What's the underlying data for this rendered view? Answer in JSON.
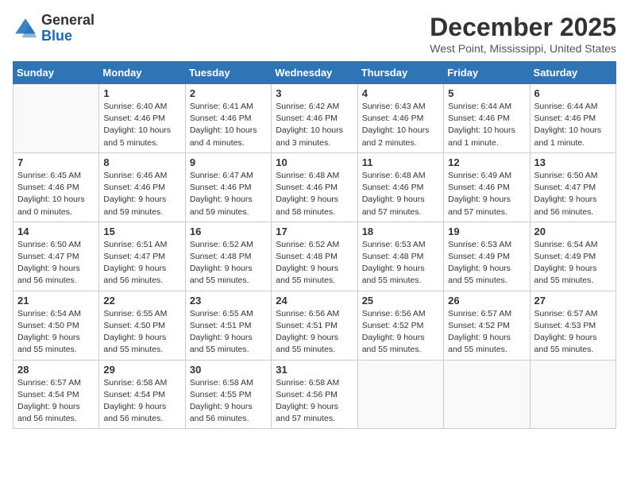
{
  "logo": {
    "general": "General",
    "blue": "Blue"
  },
  "title": "December 2025",
  "location": "West Point, Mississippi, United States",
  "weekdays": [
    "Sunday",
    "Monday",
    "Tuesday",
    "Wednesday",
    "Thursday",
    "Friday",
    "Saturday"
  ],
  "weeks": [
    [
      {
        "day": "",
        "sunrise": "",
        "sunset": "",
        "daylight": ""
      },
      {
        "day": "1",
        "sunrise": "Sunrise: 6:40 AM",
        "sunset": "Sunset: 4:46 PM",
        "daylight": "Daylight: 10 hours and 5 minutes."
      },
      {
        "day": "2",
        "sunrise": "Sunrise: 6:41 AM",
        "sunset": "Sunset: 4:46 PM",
        "daylight": "Daylight: 10 hours and 4 minutes."
      },
      {
        "day": "3",
        "sunrise": "Sunrise: 6:42 AM",
        "sunset": "Sunset: 4:46 PM",
        "daylight": "Daylight: 10 hours and 3 minutes."
      },
      {
        "day": "4",
        "sunrise": "Sunrise: 6:43 AM",
        "sunset": "Sunset: 4:46 PM",
        "daylight": "Daylight: 10 hours and 2 minutes."
      },
      {
        "day": "5",
        "sunrise": "Sunrise: 6:44 AM",
        "sunset": "Sunset: 4:46 PM",
        "daylight": "Daylight: 10 hours and 1 minute."
      },
      {
        "day": "6",
        "sunrise": "Sunrise: 6:44 AM",
        "sunset": "Sunset: 4:46 PM",
        "daylight": "Daylight: 10 hours and 1 minute."
      }
    ],
    [
      {
        "day": "7",
        "sunrise": "Sunrise: 6:45 AM",
        "sunset": "Sunset: 4:46 PM",
        "daylight": "Daylight: 10 hours and 0 minutes."
      },
      {
        "day": "8",
        "sunrise": "Sunrise: 6:46 AM",
        "sunset": "Sunset: 4:46 PM",
        "daylight": "Daylight: 9 hours and 59 minutes."
      },
      {
        "day": "9",
        "sunrise": "Sunrise: 6:47 AM",
        "sunset": "Sunset: 4:46 PM",
        "daylight": "Daylight: 9 hours and 59 minutes."
      },
      {
        "day": "10",
        "sunrise": "Sunrise: 6:48 AM",
        "sunset": "Sunset: 4:46 PM",
        "daylight": "Daylight: 9 hours and 58 minutes."
      },
      {
        "day": "11",
        "sunrise": "Sunrise: 6:48 AM",
        "sunset": "Sunset: 4:46 PM",
        "daylight": "Daylight: 9 hours and 57 minutes."
      },
      {
        "day": "12",
        "sunrise": "Sunrise: 6:49 AM",
        "sunset": "Sunset: 4:46 PM",
        "daylight": "Daylight: 9 hours and 57 minutes."
      },
      {
        "day": "13",
        "sunrise": "Sunrise: 6:50 AM",
        "sunset": "Sunset: 4:47 PM",
        "daylight": "Daylight: 9 hours and 56 minutes."
      }
    ],
    [
      {
        "day": "14",
        "sunrise": "Sunrise: 6:50 AM",
        "sunset": "Sunset: 4:47 PM",
        "daylight": "Daylight: 9 hours and 56 minutes."
      },
      {
        "day": "15",
        "sunrise": "Sunrise: 6:51 AM",
        "sunset": "Sunset: 4:47 PM",
        "daylight": "Daylight: 9 hours and 56 minutes."
      },
      {
        "day": "16",
        "sunrise": "Sunrise: 6:52 AM",
        "sunset": "Sunset: 4:48 PM",
        "daylight": "Daylight: 9 hours and 55 minutes."
      },
      {
        "day": "17",
        "sunrise": "Sunrise: 6:52 AM",
        "sunset": "Sunset: 4:48 PM",
        "daylight": "Daylight: 9 hours and 55 minutes."
      },
      {
        "day": "18",
        "sunrise": "Sunrise: 6:53 AM",
        "sunset": "Sunset: 4:48 PM",
        "daylight": "Daylight: 9 hours and 55 minutes."
      },
      {
        "day": "19",
        "sunrise": "Sunrise: 6:53 AM",
        "sunset": "Sunset: 4:49 PM",
        "daylight": "Daylight: 9 hours and 55 minutes."
      },
      {
        "day": "20",
        "sunrise": "Sunrise: 6:54 AM",
        "sunset": "Sunset: 4:49 PM",
        "daylight": "Daylight: 9 hours and 55 minutes."
      }
    ],
    [
      {
        "day": "21",
        "sunrise": "Sunrise: 6:54 AM",
        "sunset": "Sunset: 4:50 PM",
        "daylight": "Daylight: 9 hours and 55 minutes."
      },
      {
        "day": "22",
        "sunrise": "Sunrise: 6:55 AM",
        "sunset": "Sunset: 4:50 PM",
        "daylight": "Daylight: 9 hours and 55 minutes."
      },
      {
        "day": "23",
        "sunrise": "Sunrise: 6:55 AM",
        "sunset": "Sunset: 4:51 PM",
        "daylight": "Daylight: 9 hours and 55 minutes."
      },
      {
        "day": "24",
        "sunrise": "Sunrise: 6:56 AM",
        "sunset": "Sunset: 4:51 PM",
        "daylight": "Daylight: 9 hours and 55 minutes."
      },
      {
        "day": "25",
        "sunrise": "Sunrise: 6:56 AM",
        "sunset": "Sunset: 4:52 PM",
        "daylight": "Daylight: 9 hours and 55 minutes."
      },
      {
        "day": "26",
        "sunrise": "Sunrise: 6:57 AM",
        "sunset": "Sunset: 4:52 PM",
        "daylight": "Daylight: 9 hours and 55 minutes."
      },
      {
        "day": "27",
        "sunrise": "Sunrise: 6:57 AM",
        "sunset": "Sunset: 4:53 PM",
        "daylight": "Daylight: 9 hours and 55 minutes."
      }
    ],
    [
      {
        "day": "28",
        "sunrise": "Sunrise: 6:57 AM",
        "sunset": "Sunset: 4:54 PM",
        "daylight": "Daylight: 9 hours and 56 minutes."
      },
      {
        "day": "29",
        "sunrise": "Sunrise: 6:58 AM",
        "sunset": "Sunset: 4:54 PM",
        "daylight": "Daylight: 9 hours and 56 minutes."
      },
      {
        "day": "30",
        "sunrise": "Sunrise: 6:58 AM",
        "sunset": "Sunset: 4:55 PM",
        "daylight": "Daylight: 9 hours and 56 minutes."
      },
      {
        "day": "31",
        "sunrise": "Sunrise: 6:58 AM",
        "sunset": "Sunset: 4:56 PM",
        "daylight": "Daylight: 9 hours and 57 minutes."
      },
      {
        "day": "",
        "sunrise": "",
        "sunset": "",
        "daylight": ""
      },
      {
        "day": "",
        "sunrise": "",
        "sunset": "",
        "daylight": ""
      },
      {
        "day": "",
        "sunrise": "",
        "sunset": "",
        "daylight": ""
      }
    ]
  ]
}
